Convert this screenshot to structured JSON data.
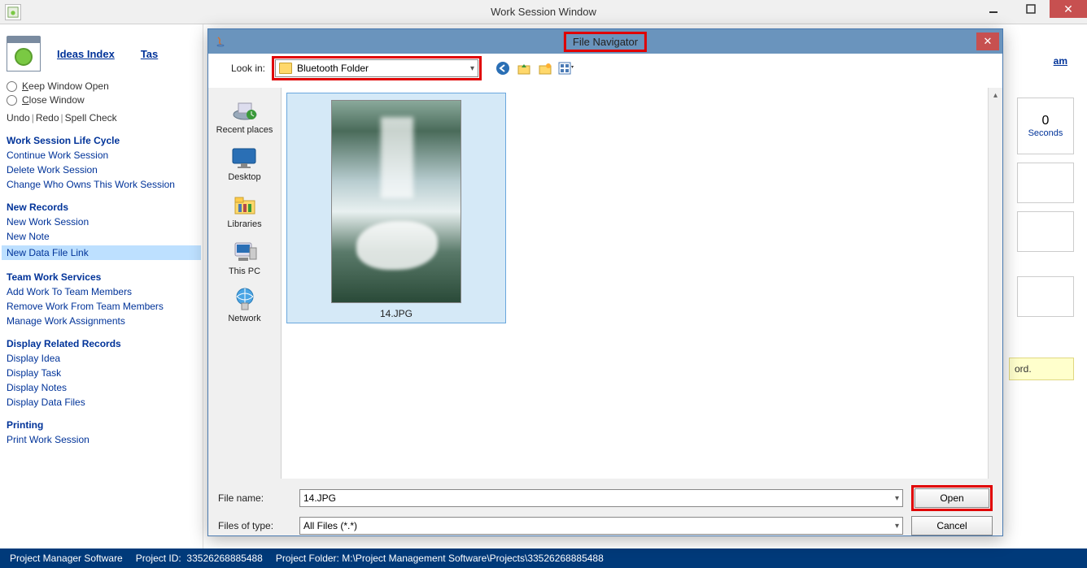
{
  "window": {
    "title": "Work Session Window",
    "minimize": "_",
    "maximize": "□",
    "close": "✕"
  },
  "sidebar": {
    "ideas_link": "Ideas Index",
    "tas_link": "Tas",
    "keep_open": "eep Window Open",
    "close_window": "lose Window",
    "undo": "Undo",
    "redo": "Redo",
    "spell": "Spell Check",
    "sections": {
      "lifecycle": {
        "head": "Work Session Life Cycle",
        "items": [
          "Continue Work Session",
          "Delete Work Session",
          "Change Who Owns This Work Session"
        ]
      },
      "newrec": {
        "head": "New Records",
        "items": [
          "New Work Session",
          "New Note",
          "New Data File Link"
        ]
      },
      "team": {
        "head": "Team Work Services",
        "items": [
          "Add Work To Team Members",
          "Remove Work From Team Members",
          "Manage Work Assignments"
        ]
      },
      "display": {
        "head": "Display Related Records",
        "items": [
          "Display Idea",
          "Display Task",
          "Display Notes",
          "Display Data Files"
        ]
      },
      "print": {
        "head": "Printing",
        "items": [
          "Print Work Session"
        ]
      }
    }
  },
  "right": {
    "zero": "0",
    "seconds": "Seconds",
    "note_frag": "ord.",
    "am_frag": "am"
  },
  "dialog": {
    "title": "File Navigator",
    "lookin_label": "Look in:",
    "lookin_value": "Bluetooth Folder",
    "places": [
      "Recent places",
      "Desktop",
      "Libraries",
      "This PC",
      "Network"
    ],
    "file_thumb": "14.JPG",
    "filename_label": "File name:",
    "filename_value": "14.JPG",
    "filetype_label": "Files of type:",
    "filetype_value": "All Files (*.*)",
    "open": "Open",
    "cancel": "Cancel"
  },
  "status": {
    "app": "Project Manager Software",
    "pid_label": "Project ID:",
    "pid": "33526268885488",
    "pfolder_label": "Project Folder:",
    "pfolder": "M:\\Project Management Software\\Projects\\33526268885488"
  }
}
